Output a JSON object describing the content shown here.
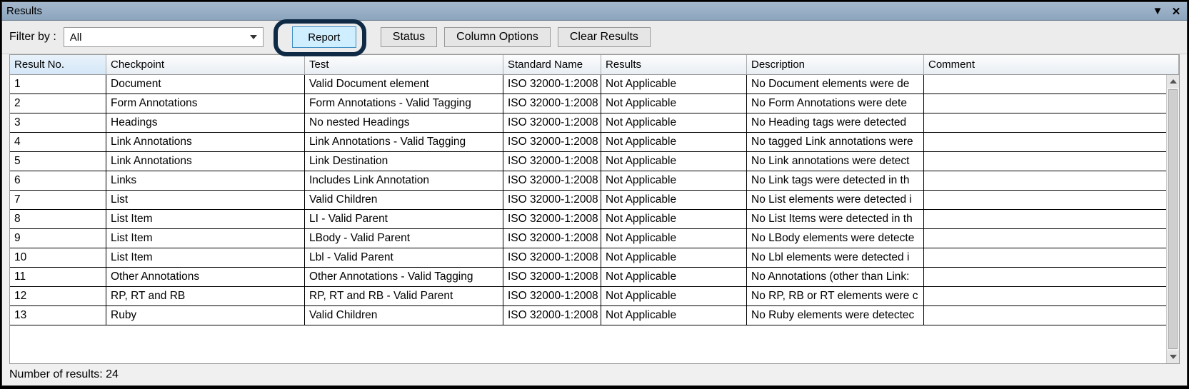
{
  "window": {
    "title": "Results"
  },
  "toolbar": {
    "filter_label": "Filter by :",
    "filter_value": "All",
    "report": "Report",
    "status": "Status",
    "column_options": "Column Options",
    "clear": "Clear Results"
  },
  "columns": {
    "no": "Result No.",
    "checkpoint": "Checkpoint",
    "test": "Test",
    "standard": "Standard Name",
    "results": "Results",
    "description": "Description",
    "comment": "Comment"
  },
  "rows": [
    {
      "no": "1",
      "cp": "Document",
      "test": "Valid Document element",
      "std": "ISO 32000-1:2008",
      "res": "Not Applicable",
      "desc": "No Document elements were de",
      "cmt": ""
    },
    {
      "no": "2",
      "cp": "Form Annotations",
      "test": "Form Annotations - Valid Tagging",
      "std": "ISO 32000-1:2008",
      "res": "Not Applicable",
      "desc": "No Form Annotations were dete",
      "cmt": ""
    },
    {
      "no": "3",
      "cp": "Headings",
      "test": "No nested Headings",
      "std": "ISO 32000-1:2008",
      "res": "Not Applicable",
      "desc": "No Heading tags were detected",
      "cmt": ""
    },
    {
      "no": "4",
      "cp": "Link Annotations",
      "test": "Link Annotations - Valid Tagging",
      "std": "ISO 32000-1:2008",
      "res": "Not Applicable",
      "desc": "No tagged Link annotations were",
      "cmt": ""
    },
    {
      "no": "5",
      "cp": "Link Annotations",
      "test": "Link Destination",
      "std": "ISO 32000-1:2008",
      "res": "Not Applicable",
      "desc": "No Link annotations were detect",
      "cmt": ""
    },
    {
      "no": "6",
      "cp": "Links",
      "test": "Includes Link Annotation",
      "std": "ISO 32000-1:2008",
      "res": "Not Applicable",
      "desc": "No Link tags were detected in th",
      "cmt": ""
    },
    {
      "no": "7",
      "cp": "List",
      "test": "Valid Children",
      "std": "ISO 32000-1:2008",
      "res": "Not Applicable",
      "desc": "No List elements were detected i",
      "cmt": ""
    },
    {
      "no": "8",
      "cp": "List Item",
      "test": "LI - Valid Parent",
      "std": "ISO 32000-1:2008",
      "res": "Not Applicable",
      "desc": "No List Items were detected in th",
      "cmt": ""
    },
    {
      "no": "9",
      "cp": "List Item",
      "test": "LBody - Valid Parent",
      "std": "ISO 32000-1:2008",
      "res": "Not Applicable",
      "desc": "No LBody elements were detecte",
      "cmt": ""
    },
    {
      "no": "10",
      "cp": "List Item",
      "test": "Lbl - Valid Parent",
      "std": "ISO 32000-1:2008",
      "res": "Not Applicable",
      "desc": "No Lbl elements were detected i",
      "cmt": ""
    },
    {
      "no": "11",
      "cp": "Other Annotations",
      "test": "Other Annotations - Valid Tagging",
      "std": "ISO 32000-1:2008",
      "res": "Not Applicable",
      "desc": "No Annotations (other than Link:",
      "cmt": ""
    },
    {
      "no": "12",
      "cp": "RP, RT and RB",
      "test": "RP, RT and RB - Valid Parent",
      "std": "ISO 32000-1:2008",
      "res": "Not Applicable",
      "desc": "No RP, RB or RT elements were c",
      "cmt": ""
    },
    {
      "no": "13",
      "cp": "Ruby",
      "test": "Valid Children",
      "std": "ISO 32000-1:2008",
      "res": "Not Applicable",
      "desc": "No Ruby elements were detectec",
      "cmt": ""
    }
  ],
  "status": {
    "text": "Number of results: 24"
  }
}
